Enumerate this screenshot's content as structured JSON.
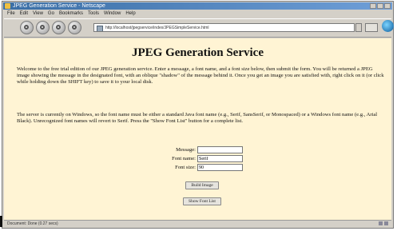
{
  "window": {
    "title": "JPEG Generation Service - Netscape"
  },
  "menubar": {
    "items": [
      "File",
      "Edit",
      "View",
      "Go",
      "Bookmarks",
      "Tools",
      "Window",
      "Help"
    ]
  },
  "toolbar": {
    "url": "http://localhost/jpegservice/index/JPEGSimpleService.html"
  },
  "page": {
    "title": "JPEG Generation Service",
    "para1": "Welcome to the free trial edition of our JPEG generation service. Enter a message, a font name, and a font size below, then submit the form. You will be returned a JPEG image showing the message in the designated font, with an oblique \"shadow\" of the message behind it. Once you get an image you are satisfied with, right click on it (or click while holding down the SHIFT key) to save it to your local disk.",
    "para2": "The server is currently on Windows, so the font name must be either a standard Java font name (e.g., Serif, SansSerif, or Monospaced) or a Windows font name (e.g., Arial Black). Unrecognized font names will revert to Serif. Press the \"Show Font List\" button for a complete list.",
    "form": {
      "message_label": "Message:",
      "message_value": "",
      "font_name_label": "Font name:",
      "font_name_value": "Serif",
      "font_size_label": "Font size:",
      "font_size_value": "90"
    },
    "build_button": "Build Image",
    "show_button": "Show Font List"
  },
  "status": {
    "text": "Document: Done (0.27 secs)"
  }
}
